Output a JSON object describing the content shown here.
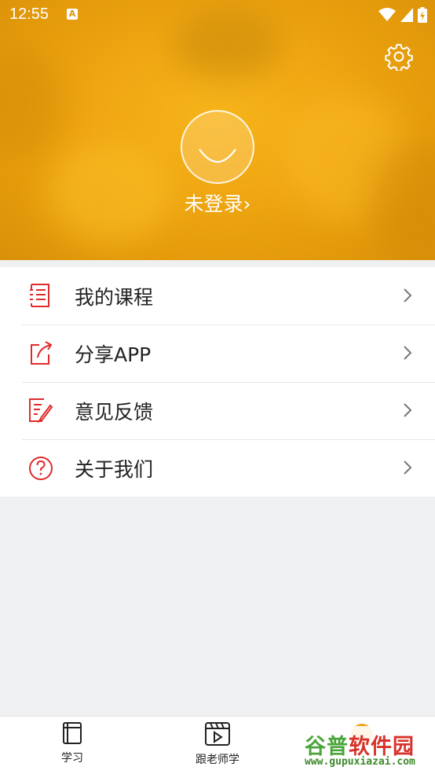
{
  "status_bar": {
    "time": "12:55",
    "notification_icon": "A"
  },
  "header": {
    "login_text": "未登录",
    "login_chevron": "›"
  },
  "menu": [
    {
      "label": "我的课程",
      "icon": "course-list-icon"
    },
    {
      "label": "分享APP",
      "icon": "share-icon"
    },
    {
      "label": "意见反馈",
      "icon": "feedback-icon"
    },
    {
      "label": "关于我们",
      "icon": "question-icon"
    }
  ],
  "tabs": [
    {
      "label": "学习",
      "icon": "notebook-icon"
    },
    {
      "label": "跟老师学",
      "icon": "video-play-icon"
    }
  ],
  "watermark": {
    "text": "谷普软件园",
    "url": "www.gupuxiazai.com"
  },
  "colors": {
    "accent": "#e02b2b",
    "header": "#f0a714"
  }
}
